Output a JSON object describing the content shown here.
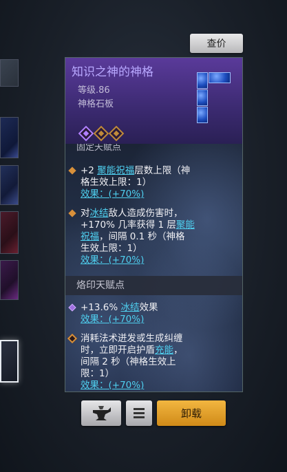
{
  "header": {
    "check_price_label": "查价"
  },
  "item": {
    "name": "知识之神的神格",
    "level": "等级.86",
    "type": "神格石板",
    "gem_icon": "tetromino-gem-icon",
    "sockets": [
      "purple",
      "orange",
      "orange"
    ]
  },
  "sections": {
    "cut_header": "固定天赋点",
    "fixed_entries": [
      {
        "line1": "+2 ",
        "link": "聚能祝福",
        "line1b": "层数上限（神",
        "line2": "格生效上限：1）",
        "effect": "效果：(+70%)"
      },
      {
        "line1": "对",
        "link": "冰结",
        "line1b": "敌人造成伤害时，",
        "line2": "+170% 几率获得 1 层",
        "link2": "聚能",
        "line3a": "祝福",
        "line3b": "，间隔 0.1 秒（神格",
        "line4": "生效上限：1）",
        "effect": "效果：(+70%)"
      }
    ],
    "brand_header": "烙印天赋点",
    "brand_entries": [
      {
        "line1": "+13.6% ",
        "link": "冰结",
        "line1b": "效果",
        "effect": "效果：(+70%)"
      },
      {
        "line1": "消耗法术迸发或生成纠缠",
        "line2a": "时，立即开启护盾",
        "link": "充能",
        "line2b": "，",
        "line3": "间隔 2 秒（神格生效上",
        "line4": "限：1）",
        "effect": "效果：(+70%)"
      }
    ]
  },
  "footer": {
    "anvil_icon": "anvil-icon",
    "menu_icon": "menu-icon",
    "unequip_label": "卸载"
  },
  "colors": {
    "accent_link": "#4fd0f0",
    "unequip_button": "#e8a42c",
    "title": "#b8a8ff"
  }
}
